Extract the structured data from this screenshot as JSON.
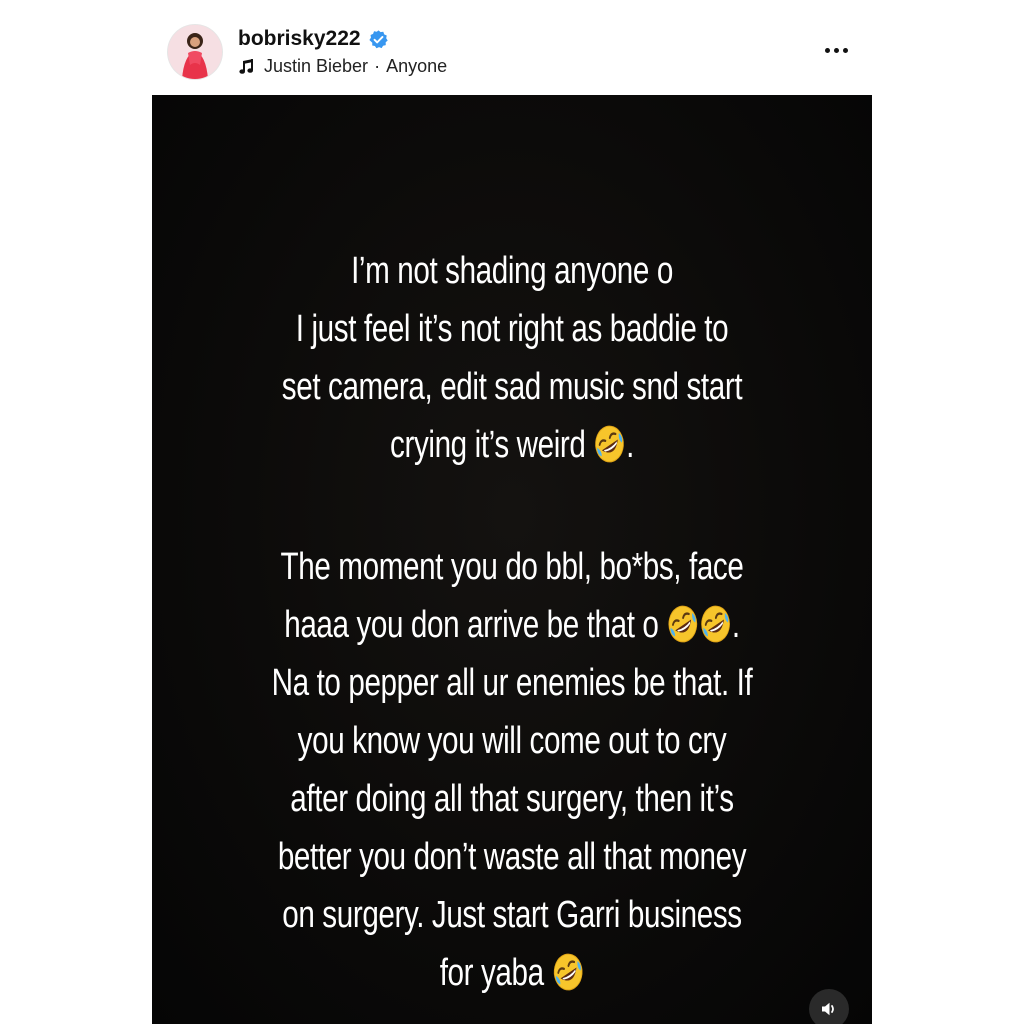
{
  "header": {
    "username": "bobrisky222",
    "music_artist": "Justin Bieber",
    "separator": "·",
    "music_title": "Anyone"
  },
  "story": {
    "block1": [
      "I’m not shading anyone o",
      "I just feel it’s not right as baddie to",
      "set camera, edit sad music snd start",
      "crying it’s weird"
    ],
    "block1_end": ".",
    "block2": [
      "The moment you do bbl, bo*bs, face",
      "haaa you don arrive be that o",
      "Na to pepper all ur enemies be that. If",
      "you know you will come out to cry",
      "after doing all that surgery, then it’s",
      "better you don’t waste all that money",
      "on surgery. Just start Garri business",
      "for yaba"
    ],
    "block2_line2_end": ".",
    "emoji": "rolling-on-floor-laughing-emoji"
  },
  "colors": {
    "verified_blue": "#3897f0",
    "story_background": "#0b0a09",
    "emoji_yellow": "#f7c52b"
  },
  "icons": [
    "verified-badge-icon",
    "music-note-icon",
    "more-options-icon",
    "sound-icon"
  ]
}
